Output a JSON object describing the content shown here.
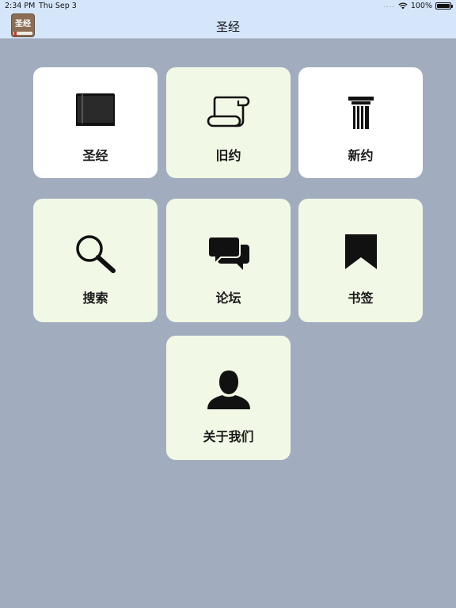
{
  "status_bar": {
    "time": "2:34 PM",
    "date": "Thu Sep 3",
    "signal_dots": "....",
    "battery": "100%"
  },
  "nav": {
    "app_icon_label": "圣经",
    "title": "圣经"
  },
  "tiles": [
    {
      "label": "圣经",
      "icon": "book-icon"
    },
    {
      "label": "旧约",
      "icon": "scroll-icon"
    },
    {
      "label": "新约",
      "icon": "pillar-icon"
    },
    {
      "label": "搜索",
      "icon": "magnifier-icon"
    },
    {
      "label": "论坛",
      "icon": "chat-bubbles-icon"
    },
    {
      "label": "书签",
      "icon": "bookmark-icon"
    },
    {
      "label": "关于我们",
      "icon": "person-icon"
    }
  ],
  "colors": {
    "background": "#a1adbf",
    "nav_bar": "#d5e6fb",
    "tile_white": "#ffffff",
    "tile_green": "#f2f8e6",
    "icon": "#111111"
  }
}
